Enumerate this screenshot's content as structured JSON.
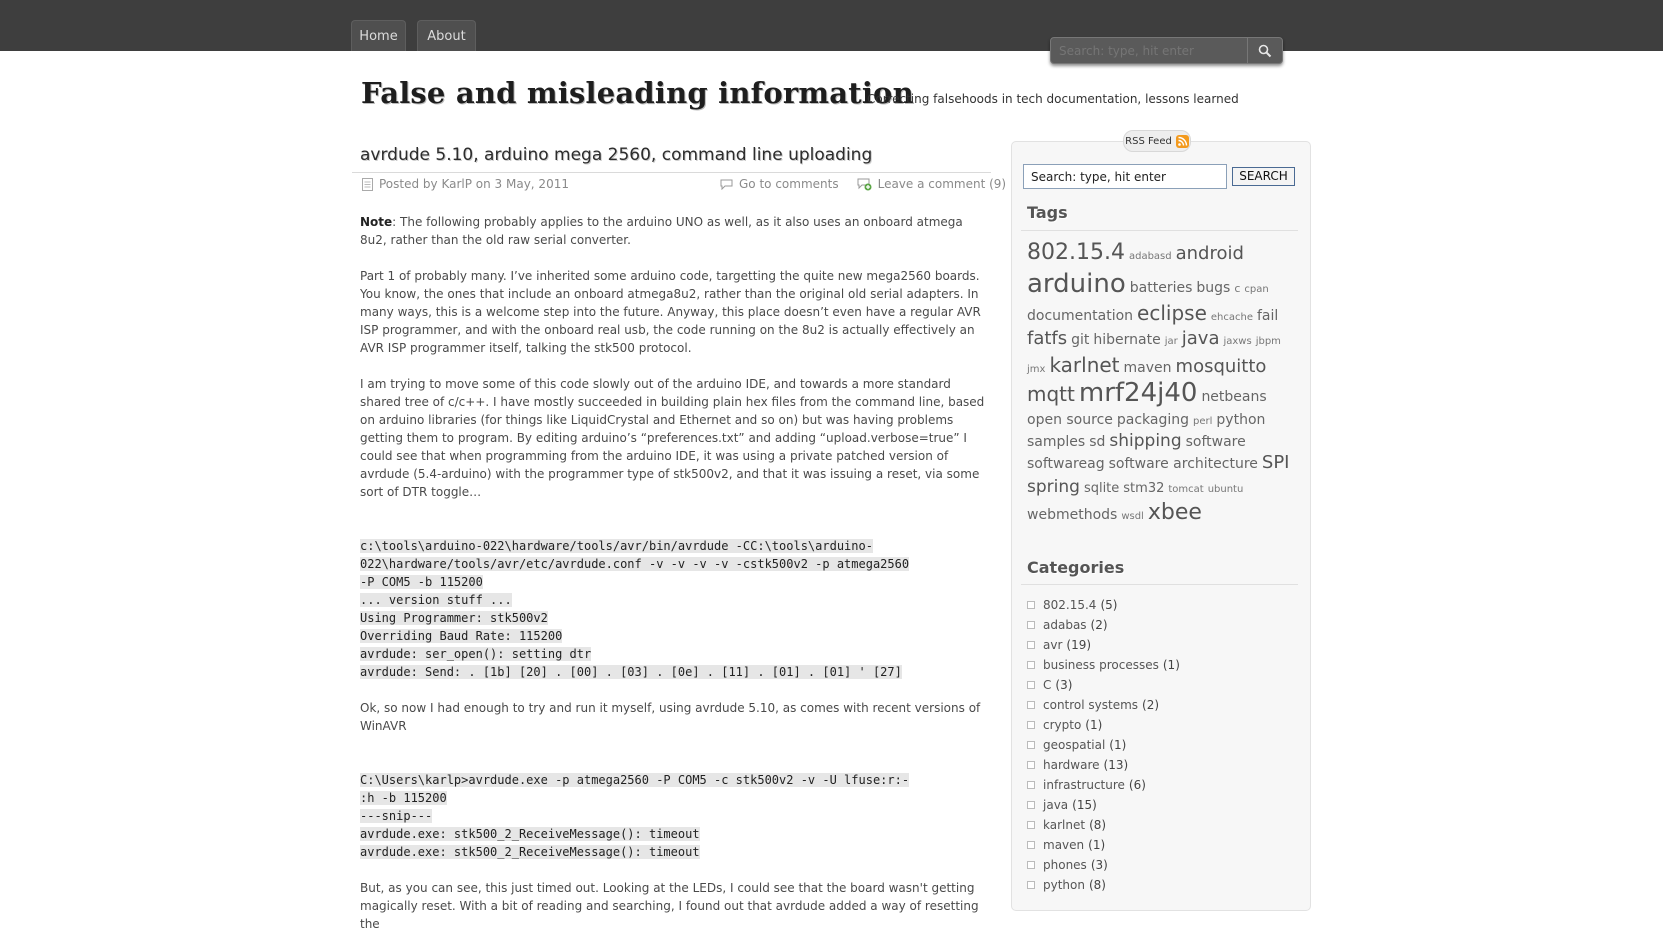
{
  "nav": {
    "tabs": [
      {
        "label": "Home"
      },
      {
        "label": "About"
      }
    ]
  },
  "top_search": {
    "placeholder": "Search: type, hit enter",
    "icon": "search-icon"
  },
  "site": {
    "title": "False and misleading information",
    "tagline": "Correcting falsehoods in tech documentation, lessons learned"
  },
  "post": {
    "title": "avrdude 5.10, arduino mega 2560, command line uploading",
    "meta": {
      "posted_by": "Posted by KarlP on 3 May, 2011",
      "go_to_comments": "Go to comments",
      "leave_comment": "Leave a comment (9)"
    },
    "note_label": "Note",
    "note_text": ": The following probably applies to the arduino UNO as well, as it also uses an onboard atmega 8u2, rather than the old raw serial converter.",
    "para1": "Part 1 of probably many. I’ve inherited some arduino code, targetting the quite new mega2560 boards. You know, the ones that include an onboard atmega8u2, rather than the original old serial adapters. In many ways, this is a welcome step into the future. Anyway, this place doesn’t even have a regular AVR ISP programmer, and with the onboard real usb, the code running on the 8u2 is actually effectively an AVR ISP programmer itself, talking the stk500 protocol.",
    "para2": "I am trying to move some of this code slowly out of the arduino IDE, and towards a more standard shared tree of c/c++. I have mostly succeeded in building plain hex files from the command line, based on arduino libraries (for things like LiquidCrystal and Ethernet and so on) but was having problems getting them to program. By editing arduino’s “preferences.txt” and adding “upload.verbose=true” I could see that when programming from the arduino IDE, it was using a private patched version of avrdude (5.4-arduino) with the programmer type of stk500v2, and that it was issuing a reset, via some sort of DTR toggle…",
    "code1": [
      "c:\\tools\\arduino-022\\hardware/tools/avr/bin/avrdude -CC:\\tools\\arduino-",
      "022\\hardware/tools/avr/etc/avrdude.conf -v -v -v -v -cstk500v2 -p atmega2560",
      "-P COM5 -b 115200",
      "... version stuff ...",
      "Using Programmer: stk500v2",
      "Overriding Baud Rate: 115200",
      "avrdude: ser_open(): setting dtr",
      "avrdude: Send: . [1b] [20] . [00] . [03] . [0e] . [11] . [01] . [01] ' [27]"
    ],
    "para3": "Ok, so now I had enough to try and run it myself, using avrdude 5.10, as comes with recent versions of WinAVR",
    "code2": [
      "C:\\Users\\karlp>avrdude.exe -p atmega2560 -P COM5 -c stk500v2 -v -U lfuse:r:-",
      ":h -b 115200",
      "---snip---",
      "avrdude.exe: stk500_2_ReceiveMessage(): timeout",
      "avrdude.exe: stk500_2_ReceiveMessage(): timeout"
    ],
    "para4": "But, as you can see, this just timed out. Looking at the LEDs, I could see that the board wasn't getting magically reset. With a bit of reading and searching, I found out that avrdude added a way of resetting the"
  },
  "sidebar": {
    "rss_label": "RSS Feed",
    "search_value": "Search: type, hit enter",
    "search_button": "SEARCH",
    "tags_title": "Tags",
    "tags": [
      {
        "label": "802.15.4",
        "size": 22
      },
      {
        "label": "adabasd",
        "size": 10
      },
      {
        "label": "android",
        "size": 18
      },
      {
        "label": "arduino",
        "size": 26
      },
      {
        "label": "batteries",
        "size": 14
      },
      {
        "label": "bugs",
        "size": 14
      },
      {
        "label": "c",
        "size": 11
      },
      {
        "label": "cpan",
        "size": 10
      },
      {
        "label": "documentation",
        "size": 14
      },
      {
        "label": "eclipse",
        "size": 20
      },
      {
        "label": "ehcache",
        "size": 10
      },
      {
        "label": "fail",
        "size": 14
      },
      {
        "label": "fatfs",
        "size": 18
      },
      {
        "label": "git",
        "size": 14
      },
      {
        "label": "hibernate",
        "size": 14
      },
      {
        "label": "jar",
        "size": 10
      },
      {
        "label": "java",
        "size": 18
      },
      {
        "label": "jaxws",
        "size": 10
      },
      {
        "label": "jbpm",
        "size": 10
      },
      {
        "label": "jmx",
        "size": 10
      },
      {
        "label": "karlnet",
        "size": 20
      },
      {
        "label": "maven",
        "size": 14
      },
      {
        "label": "mosquitto",
        "size": 18
      },
      {
        "label": "mqtt",
        "size": 20
      },
      {
        "label": "mrf24j40",
        "size": 26
      },
      {
        "label": "netbeans",
        "size": 14
      },
      {
        "label": "open source",
        "size": 14
      },
      {
        "label": "packaging",
        "size": 14
      },
      {
        "label": "perl",
        "size": 10
      },
      {
        "label": "python",
        "size": 14
      },
      {
        "label": "samples",
        "size": 14
      },
      {
        "label": "sd",
        "size": 14
      },
      {
        "label": "shipping",
        "size": 17
      },
      {
        "label": "software",
        "size": 14
      },
      {
        "label": "softwareag",
        "size": 14
      },
      {
        "label": "software architecture",
        "size": 14
      },
      {
        "label": "SPI",
        "size": 18
      },
      {
        "label": "spring",
        "size": 17
      },
      {
        "label": "sqlite",
        "size": 13
      },
      {
        "label": "stm32",
        "size": 13
      },
      {
        "label": "tomcat",
        "size": 10
      },
      {
        "label": "ubuntu",
        "size": 10
      },
      {
        "label": "webmethods",
        "size": 14
      },
      {
        "label": "wsdl",
        "size": 10
      },
      {
        "label": "xbee",
        "size": 22
      }
    ],
    "categories_title": "Categories",
    "categories": [
      {
        "name": "802.15.4",
        "count": "(5)"
      },
      {
        "name": "adabas",
        "count": "(2)"
      },
      {
        "name": "avr",
        "count": "(19)"
      },
      {
        "name": "business processes",
        "count": "(1)"
      },
      {
        "name": "C",
        "count": "(3)"
      },
      {
        "name": "control systems",
        "count": "(2)"
      },
      {
        "name": "crypto",
        "count": "(1)"
      },
      {
        "name": "geospatial",
        "count": "(1)"
      },
      {
        "name": "hardware",
        "count": "(13)"
      },
      {
        "name": "infrastructure",
        "count": "(6)"
      },
      {
        "name": "java",
        "count": "(15)"
      },
      {
        "name": "karlnet",
        "count": "(8)"
      },
      {
        "name": "maven",
        "count": "(1)"
      },
      {
        "name": "phones",
        "count": "(3)"
      },
      {
        "name": "python",
        "count": "(8)"
      }
    ]
  }
}
